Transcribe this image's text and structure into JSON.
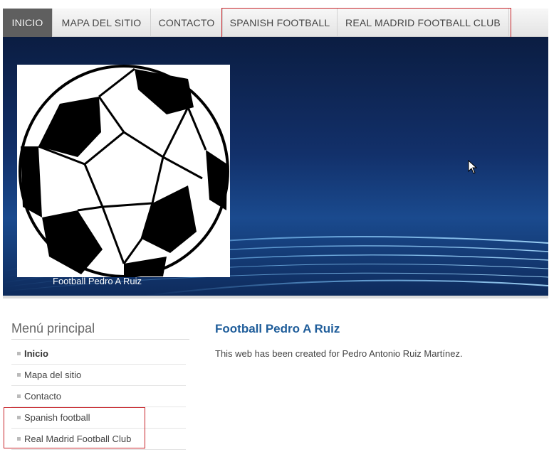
{
  "nav": {
    "items": [
      {
        "label": "INICIO",
        "active": true
      },
      {
        "label": "MAPA DEL SITIO",
        "active": false
      },
      {
        "label": "CONTACTO",
        "active": false
      },
      {
        "label": "SPANISH FOOTBALL",
        "active": false
      },
      {
        "label": "REAL MADRID FOOTBALL CLUB",
        "active": false
      }
    ]
  },
  "banner": {
    "caption": "Football Pedro A Ruiz",
    "logo_icon": "soccer-ball-icon"
  },
  "sidebar": {
    "title": "Menú principal",
    "items": [
      {
        "label": "Inicio"
      },
      {
        "label": "Mapa del sitio"
      },
      {
        "label": "Contacto"
      },
      {
        "label": "Spanish football"
      },
      {
        "label": "Real Madrid Football Club"
      }
    ]
  },
  "main": {
    "title": "Football Pedro A Ruiz",
    "text": "This web has been created for Pedro Antonio Ruiz Martínez."
  },
  "colors": {
    "highlight": "#c8242a",
    "link_blue": "#1f5d9a",
    "banner_dark": "#0b1d42"
  }
}
